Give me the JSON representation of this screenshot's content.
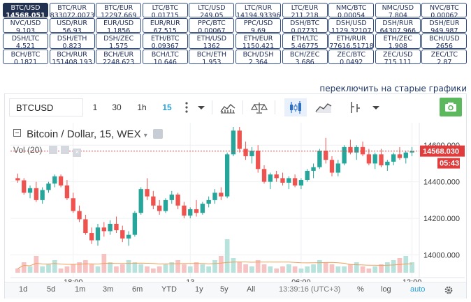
{
  "pairs": [
    {
      "label": "BTC/USD",
      "value": "14568.051",
      "active": true
    },
    {
      "label": "BTC/RUR",
      "value": "833072.0073"
    },
    {
      "label": "BTC/EUR",
      "value": "12297.669"
    },
    {
      "label": "LTC/BTC",
      "value": "0.01715"
    },
    {
      "label": "LTC/USD",
      "value": "249.05"
    },
    {
      "label": "LTC/RUR",
      "value": "14194.93396"
    },
    {
      "label": "LTC/EUR",
      "value": "211.218"
    },
    {
      "label": "NMC/BTC",
      "value": "0.00054"
    },
    {
      "label": "NMC/USD",
      "value": "7.804"
    },
    {
      "label": "NVC/BTC",
      "value": "0.00062"
    },
    {
      "label": "NVC/USD",
      "value": "9.103"
    },
    {
      "label": "USD/RUR",
      "value": "56.93"
    },
    {
      "label": "EUR/USD",
      "value": "1.1856"
    },
    {
      "label": "EUR/RUR",
      "value": "67.515"
    },
    {
      "label": "PPC/BTC",
      "value": "0.00067"
    },
    {
      "label": "PPC/USD",
      "value": "9.69"
    },
    {
      "label": "DSH/BTC",
      "value": "0.07731"
    },
    {
      "label": "DSH/USD",
      "value": "1129.32107"
    },
    {
      "label": "DSH/RUR",
      "value": "64307.966"
    },
    {
      "label": "DSH/EUR",
      "value": "949.987"
    },
    {
      "label": "DSH/LTC",
      "value": "4.521"
    },
    {
      "label": "DSH/ETH",
      "value": "0.823"
    },
    {
      "label": "DSH/ZEC",
      "value": "1.575"
    },
    {
      "label": "ETH/BTC",
      "value": "0.09367"
    },
    {
      "label": "ETH/USD",
      "value": "1362"
    },
    {
      "label": "ETH/EUR",
      "value": "1150.421"
    },
    {
      "label": "ETH/LTC",
      "value": "5.46775"
    },
    {
      "label": "ETH/RUR",
      "value": "77616.51718"
    },
    {
      "label": "ETH/ZEC",
      "value": "1.908"
    },
    {
      "label": "BCH/USD",
      "value": "2656"
    },
    {
      "label": "BCH/BTC",
      "value": "0.1821"
    },
    {
      "label": "BCH/RUR",
      "value": "151408.193"
    },
    {
      "label": "BCH/EUR",
      "value": "2248.623"
    },
    {
      "label": "BCH/LTC",
      "value": "10.646"
    },
    {
      "label": "BCH/ETH",
      "value": "1.953"
    },
    {
      "label": "BCH/DSH",
      "value": "2.364"
    },
    {
      "label": "BCH/ZEC",
      "value": "3.686"
    },
    {
      "label": "ZEC/BTC",
      "value": "0.0492"
    },
    {
      "label": "ZEC/USD",
      "value": "715.111"
    },
    {
      "label": "ZEC/LTC",
      "value": "2.87"
    }
  ],
  "switch_link": "переключить на старые графики",
  "toolbar": {
    "symbol": "BTCUSD",
    "intervals": [
      "1",
      "30",
      "1h",
      "15"
    ],
    "selected_interval": "15",
    "icons": [
      "more-dots-icon",
      "chevron-down-icon",
      "bar-style-icon",
      "compare-scales-icon",
      "candles-icon",
      "line-style-icon",
      "indicators-icon",
      "chevron-down-icon",
      "camera-icon"
    ]
  },
  "legend": {
    "title": "Bitcoin / Dollar, 15, WEX",
    "volume_label": "Vol (20)"
  },
  "price_labels": {
    "current": "14568.030",
    "countdown": "05:43"
  },
  "colors": {
    "up": "#26a69a",
    "down": "#ef5350",
    "accent": "#2a9fd6",
    "current_price": "#e23b3b",
    "active_pair_bg": "#22314f"
  },
  "time_range_buttons": [
    "1d",
    "5d",
    "1m",
    "3m",
    "6m",
    "YTD",
    "1y",
    "5y",
    "All"
  ],
  "clock": "13:39:16 (UTC+3)",
  "scale_buttons": [
    "%",
    "log",
    "auto"
  ],
  "settings_icon": "gear-icon",
  "chart_data": {
    "type": "candlestick",
    "title": "Bitcoin / Dollar, 15, WEX",
    "ylim": [
      13960,
      14700
    ],
    "y_ticks": [
      "14600.000",
      "14400.000",
      "14200.000",
      "14000.000"
    ],
    "y_tick_values": [
      14600,
      14400,
      14200,
      14000
    ],
    "x_ticks": [
      "18:00",
      "13",
      "06:00",
      "12:00"
    ],
    "x_tick_index": [
      9,
      28,
      46,
      64
    ],
    "current_price": 14568.03,
    "candles": [
      [
        14420,
        14445,
        14395,
        14408
      ],
      [
        14408,
        14420,
        14330,
        14340
      ],
      [
        14340,
        14380,
        14310,
        14365
      ],
      [
        14365,
        14400,
        14290,
        14300
      ],
      [
        14300,
        14370,
        14280,
        14355
      ],
      [
        14355,
        14400,
        14340,
        14390
      ],
      [
        14390,
        14440,
        14370,
        14430
      ],
      [
        14430,
        14440,
        14370,
        14380
      ],
      [
        14380,
        14410,
        14300,
        14310
      ],
      [
        14310,
        14340,
        14230,
        14240
      ],
      [
        14240,
        14270,
        14180,
        14195
      ],
      [
        14195,
        14220,
        14110,
        14120
      ],
      [
        14120,
        14150,
        14060,
        14080
      ],
      [
        14080,
        14170,
        14050,
        14150
      ],
      [
        14150,
        14180,
        14100,
        14130
      ],
      [
        14130,
        14190,
        14110,
        14170
      ],
      [
        14170,
        14210,
        14120,
        14135
      ],
      [
        14135,
        14160,
        14070,
        14090
      ],
      [
        14090,
        14130,
        14050,
        14110
      ],
      [
        14110,
        14240,
        14100,
        14230
      ],
      [
        14230,
        14370,
        14220,
        14360
      ],
      [
        14360,
        14420,
        14300,
        14320
      ],
      [
        14320,
        14350,
        14250,
        14270
      ],
      [
        14270,
        14300,
        14220,
        14240
      ],
      [
        14240,
        14310,
        14230,
        14300
      ],
      [
        14300,
        14350,
        14280,
        14330
      ],
      [
        14330,
        14340,
        14250,
        14270
      ],
      [
        14270,
        14290,
        14200,
        14215
      ],
      [
        14215,
        14260,
        14200,
        14250
      ],
      [
        14250,
        14300,
        14210,
        14230
      ],
      [
        14230,
        14290,
        14220,
        14280
      ],
      [
        14280,
        14320,
        14260,
        14300
      ],
      [
        14300,
        14360,
        14280,
        14340
      ],
      [
        14340,
        14370,
        14300,
        14320
      ],
      [
        14320,
        14560,
        14310,
        14550
      ],
      [
        14550,
        14700,
        14540,
        14680
      ],
      [
        14680,
        14700,
        14560,
        14580
      ],
      [
        14580,
        14620,
        14520,
        14540
      ],
      [
        14540,
        14590,
        14500,
        14570
      ],
      [
        14570,
        14600,
        14450,
        14470
      ],
      [
        14470,
        14490,
        14390,
        14400
      ],
      [
        14400,
        14450,
        14360,
        14440
      ],
      [
        14440,
        14460,
        14400,
        14420
      ],
      [
        14420,
        14450,
        14380,
        14395
      ],
      [
        14395,
        14430,
        14360,
        14420
      ],
      [
        14420,
        14440,
        14370,
        14380
      ],
      [
        14380,
        14420,
        14360,
        14410
      ],
      [
        14410,
        14470,
        14400,
        14460
      ],
      [
        14460,
        14500,
        14420,
        14480
      ],
      [
        14480,
        14580,
        14470,
        14570
      ],
      [
        14570,
        14640,
        14500,
        14520
      ],
      [
        14520,
        14540,
        14430,
        14450
      ],
      [
        14450,
        14520,
        14430,
        14500
      ],
      [
        14500,
        14600,
        14490,
        14590
      ],
      [
        14590,
        14630,
        14550,
        14560
      ],
      [
        14560,
        14600,
        14520,
        14590
      ],
      [
        14590,
        14620,
        14540,
        14550
      ],
      [
        14550,
        14580,
        14490,
        14500
      ],
      [
        14500,
        14560,
        14470,
        14550
      ],
      [
        14550,
        14580,
        14480,
        14490
      ],
      [
        14490,
        14520,
        14460,
        14510
      ],
      [
        14510,
        14560,
        14490,
        14550
      ],
      [
        14550,
        14590,
        14520,
        14530
      ],
      [
        14530,
        14570,
        14500,
        14560
      ],
      [
        14560,
        14590,
        14540,
        14568
      ]
    ],
    "volume": [
      2,
      5,
      3,
      8,
      3,
      4,
      6,
      2,
      3,
      4,
      5,
      6,
      4,
      3,
      9,
      5,
      3,
      4,
      6,
      5,
      4,
      3,
      2,
      3,
      4,
      5,
      6,
      4,
      3,
      5,
      4,
      3,
      6,
      8,
      16,
      7,
      5,
      4,
      3,
      6,
      4,
      3,
      2,
      3,
      4,
      3,
      2,
      3,
      4,
      6,
      5,
      4,
      3,
      3,
      4,
      5,
      3,
      2,
      3,
      4,
      5,
      6,
      7,
      8,
      5
    ]
  }
}
